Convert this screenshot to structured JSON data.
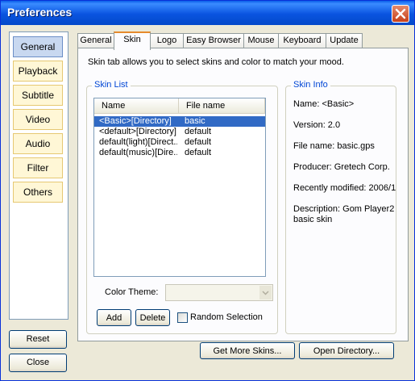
{
  "window": {
    "title": "Preferences"
  },
  "sidebar": {
    "items": [
      {
        "label": "General",
        "active": true
      },
      {
        "label": "Playback"
      },
      {
        "label": "Subtitle"
      },
      {
        "label": "Video"
      },
      {
        "label": "Audio"
      },
      {
        "label": "Filter"
      },
      {
        "label": "Others"
      }
    ],
    "reset_label": "Reset",
    "close_label": "Close"
  },
  "tabs": [
    "General",
    "Skin",
    "Logo",
    "Easy Browser",
    "Mouse",
    "Keyboard",
    "Update"
  ],
  "active_tab": "Skin",
  "skin": {
    "description": "Skin tab allows you to select skins and color to match your mood.",
    "skin_list": {
      "title": "Skin List",
      "columns": [
        "Name",
        "File name"
      ],
      "rows": [
        {
          "name": "<Basic>[Directory]",
          "file": "basic",
          "selected": true
        },
        {
          "name": "<default>[Directory]",
          "file": "default"
        },
        {
          "name": "default(light)[Direct...",
          "file": "default"
        },
        {
          "name": "default(music)[Dire...",
          "file": "default"
        }
      ],
      "color_theme_label": "Color Theme:",
      "color_theme_value": "",
      "add_label": "Add",
      "delete_label": "Delete",
      "random_selection_label": "Random Selection",
      "random_selection_checked": false
    },
    "skin_info": {
      "title": "Skin Info",
      "name": "Name: <Basic>",
      "version": "Version: 2.0",
      "file_name": "File name: basic.gps",
      "producer": "Producer: Gretech Corp.",
      "recently_modified": "Recently modified: 2006/1",
      "description_line1": "Description: Gom Player2",
      "description_line2": "basic skin"
    },
    "get_more_skins_label": "Get More Skins...",
    "open_directory_label": "Open Directory..."
  },
  "colors": {
    "title_bar": "#0a54e0",
    "selection": "#316ac5",
    "group_title": "#0046d5"
  }
}
